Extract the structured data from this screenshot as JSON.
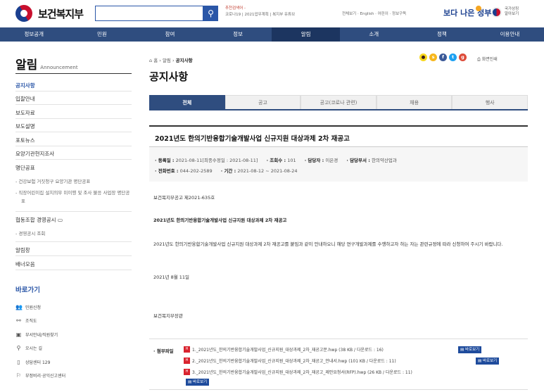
{
  "header": {
    "brand": "보건복지부",
    "search_placeholder": "",
    "rec_label": "추천검색어 -",
    "rec_terms": "코로나19 | 2021업무계획 | 복지부 유튜브",
    "util_links": "전체보기 · English · 어린이 · 정보구독",
    "better_gov": "보다 나은 정부",
    "national_symbol_line1": "국가상징",
    "national_symbol_line2": "알아보기"
  },
  "nav": [
    "정보공개",
    "민원",
    "참여",
    "정보",
    "알림",
    "소개",
    "정책",
    "이용안내"
  ],
  "nav_active": "알림",
  "sidebar": {
    "title": "알림",
    "subtitle": "Announcement",
    "items": [
      "공지사항",
      "입찰안내",
      "보도자료",
      "보도설명",
      "포토뉴스",
      "요양기관현지조사",
      "명단공표"
    ],
    "sub_items_a": [
      "- 건강보험 거짓청구 요양기관 명단공표",
      "- 직장어린이집 설치의무 미이행 및 조사 불응 사업장 명단공표"
    ],
    "item_coop": "협동조합 경영공시",
    "sub_items_b": [
      "- 경영공시 조회"
    ],
    "items_b": [
      "알림창",
      "배너모음"
    ],
    "quick_title": "바로가기",
    "quick_links": [
      "민원신청",
      "조직도",
      "부서안내/직원찾기",
      "오시는 길",
      "상담센터 129",
      "부정비리·공익신고센터"
    ]
  },
  "breadcrumb": {
    "home": "홈",
    "level1": "알림",
    "current": "공지사항"
  },
  "print_label": "화면인쇄",
  "page_title": "공지사항",
  "tabs": [
    "전체",
    "공고",
    "공고(코로나 관련)",
    "채용",
    "행사"
  ],
  "article": {
    "title": "2021년도 한의기반융합기술개발사업 신규지원 대상과제 2차 재공고",
    "meta": {
      "reg_label": "· 등록일 :",
      "reg_value": "2021-08-11[최종수정일 : 2021-08-11]",
      "views_label": "· 조회수 :",
      "views_value": "101",
      "author_label": "· 담당자 :",
      "author_value": "이은경",
      "dept_label": "· 담당부서 :",
      "dept_value": "한의약산업과",
      "phone_label": "· 전화번호 :",
      "phone_value": "044-202-2589",
      "period_label": "· 기간 :",
      "period_value": "2021-08-12 ~ 2021-08-24"
    },
    "notice_no": "보건복지부공고 제2021-635호",
    "body_title": "2021년도 한의기반융합기술개발사업 신규지원 대상과제 2차 재공고",
    "body_text": "2021년도 한의기반융합기술개발사업 신규지원 대상과제 2차 재공고를 붙임과 같이 안내하오니 해당 연구개발과제를 수행하고자 하는 자는 관련규정에 따라 신청하여 주시기 바랍니다.",
    "date": "2021년 8월 11일",
    "signer": "보건복지부장관",
    "attach_label": "· 첨부파일",
    "attachments": [
      "1._2021년도_한의기반융합기술개발사업_신규지원_대상과제_2차_재공고문.hwp (38 KB / 다운로드 : 16)",
      "2._2021년도_한의기반융합기술개발사업_신규지원_대상과제_2차_재공고_안내서.hwp (101 KB / 다운로드 : 11)",
      "3._2021년도_한의기반융합기술개발사업_신규지원_대상과제_2차_재공고_제안요청서(RFP).hwp (26 KB / 다운로드 : 11)"
    ],
    "view_label": "바로보기"
  },
  "colors": {
    "nav": "#2f4d7f",
    "nav_active": "#1c3560",
    "accent": "#2a56a7"
  }
}
